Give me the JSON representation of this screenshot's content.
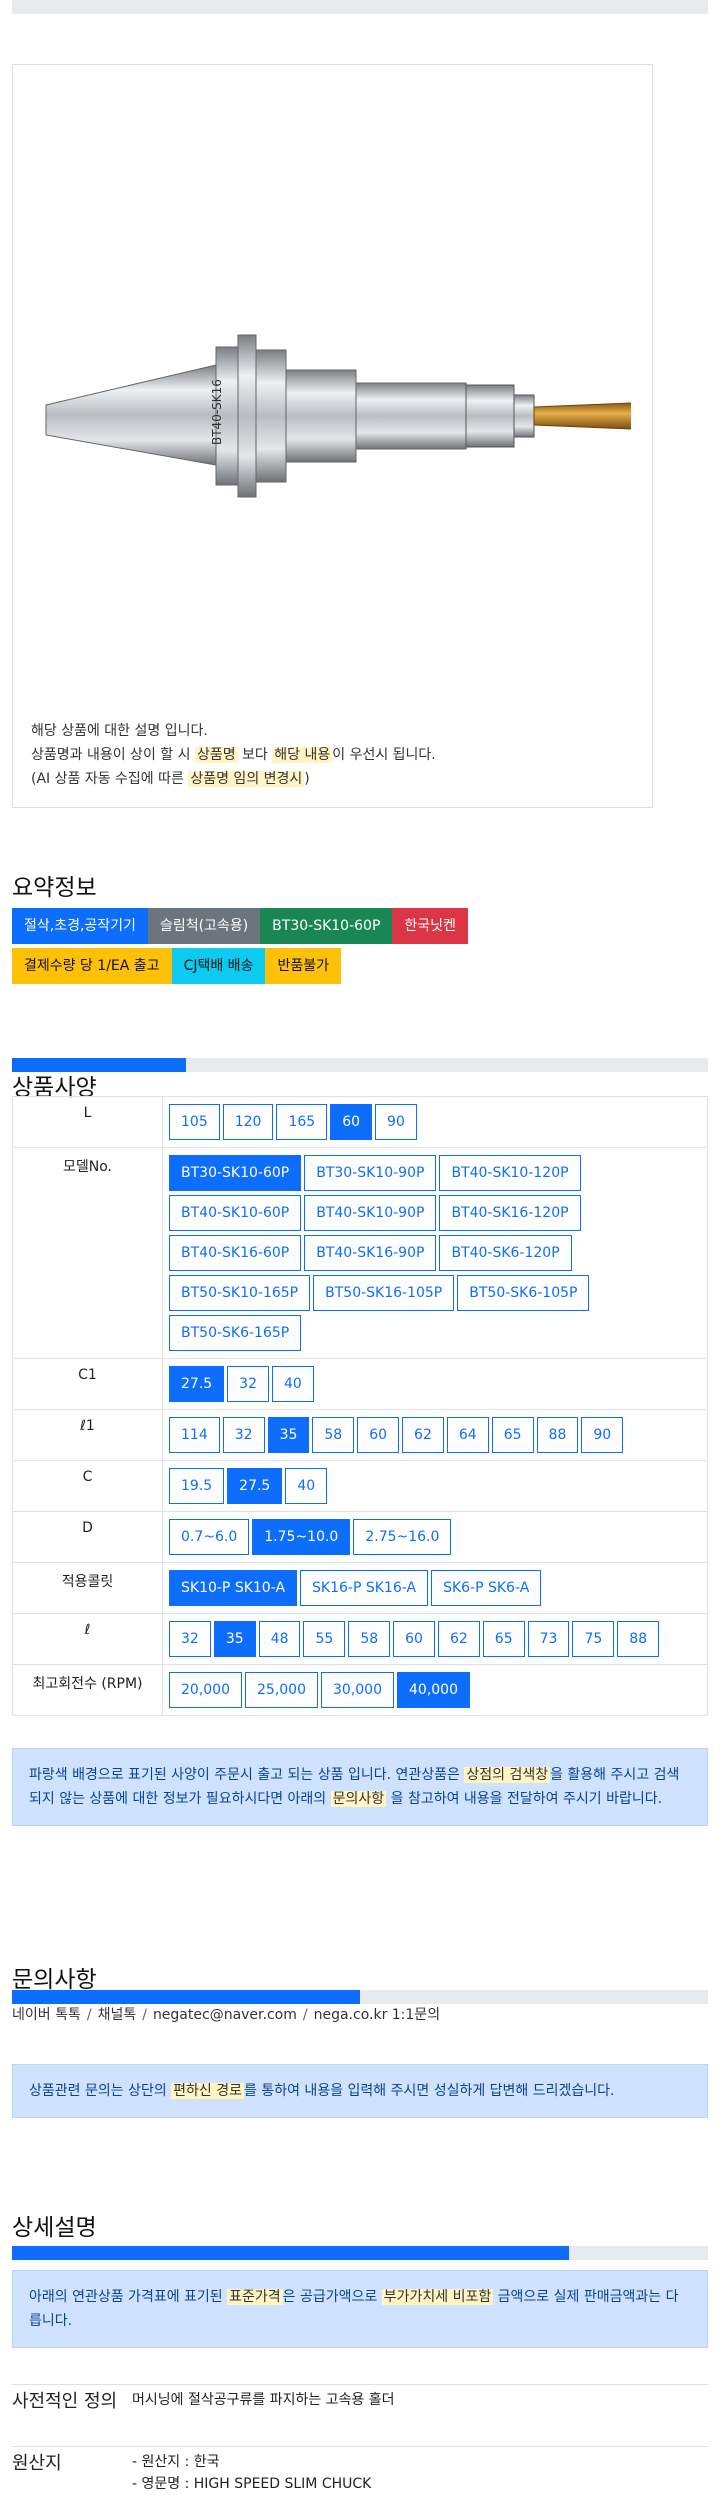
{
  "product_image_alt": "tool holder with drill",
  "product_image_label": "BT40-SK16",
  "description": {
    "line1": "해당 상품에 대한 설명 입니다.",
    "line2_a": "상품명과 내용이 상이 할 시 ",
    "line2_hl1": "상품명",
    "line2_b": " 보다 ",
    "line2_hl2": "해당 내용",
    "line2_c": "이 우선시 됩니다.",
    "line3_a": "(AI 상품 자동 수집에 따른 ",
    "line3_hl": "상품명 임의 변경시",
    "line3_b": ")"
  },
  "summary": {
    "title": "요약정보",
    "badges_row1": [
      {
        "label": "절삭,초경,공작기기",
        "color": "#0d6efd"
      },
      {
        "label": "슬림척(고속용)",
        "color": "#6c757d"
      },
      {
        "label": "BT30-SK10-60P",
        "color": "#198754"
      },
      {
        "label": "한국닛켄",
        "color": "#dc3545"
      }
    ],
    "badges_row2": [
      {
        "label": "결제수량 당 1/EA 출고",
        "color": "#ffc107"
      },
      {
        "label": "CJ택배 배송",
        "color": "#0dcaf0"
      },
      {
        "label": "반품불가",
        "color": "#ffc107"
      }
    ]
  },
  "spec": {
    "title": "상품사양",
    "progress": 0.25,
    "rows": [
      {
        "label": "L",
        "options": [
          "105",
          "120",
          "165",
          "60",
          "90"
        ],
        "selected": "60"
      },
      {
        "label": "모델No.",
        "options": [
          "BT30-SK10-60P",
          "BT30-SK10-90P",
          "BT40-SK10-120P",
          "BT40-SK10-60P",
          "BT40-SK10-90P",
          "BT40-SK16-120P",
          "BT40-SK16-60P",
          "BT40-SK16-90P",
          "BT40-SK6-120P",
          "BT50-SK10-165P",
          "BT50-SK16-105P",
          "BT50-SK6-105P",
          "BT50-SK6-165P"
        ],
        "selected": "BT30-SK10-60P"
      },
      {
        "label": "C1",
        "options": [
          "27.5",
          "32",
          "40"
        ],
        "selected": "27.5"
      },
      {
        "label": "ℓ1",
        "options": [
          "114",
          "32",
          "35",
          "58",
          "60",
          "62",
          "64",
          "65",
          "88",
          "90"
        ],
        "selected": "35"
      },
      {
        "label": "C",
        "options": [
          "19.5",
          "27.5",
          "40"
        ],
        "selected": "27.5"
      },
      {
        "label": "D",
        "options": [
          "0.7~6.0",
          "1.75~10.0",
          "2.75~16.0"
        ],
        "selected": "1.75~10.0"
      },
      {
        "label": "적용콜릿",
        "options": [
          "SK10-P SK10-A",
          "SK16-P SK16-A",
          "SK6-P SK6-A"
        ],
        "selected": "SK10-P SK10-A"
      },
      {
        "label": "ℓ",
        "options": [
          "32",
          "35",
          "48",
          "55",
          "58",
          "60",
          "62",
          "65",
          "73",
          "75",
          "88"
        ],
        "selected": "35"
      },
      {
        "label": "최고회전수 (RPM)",
        "options": [
          "20,000",
          "25,000",
          "30,000",
          "40,000"
        ],
        "selected": "40,000"
      }
    ],
    "notice": {
      "a": "파랑색 배경으로 표기된 사양이 주문시 출고 되는 상품 입니다. 연관상품은 ",
      "hl1": "상점의 검색창",
      "b": "을 활용해 주시고 검색되지 않는 상품에 대한 정보가 필요하시다면 아래의 ",
      "hl2": "문의사항",
      "c": " 을 참고하여 내용을 전달하여 주시기 바랍니다."
    }
  },
  "inquiry": {
    "title": "문의사항",
    "progress": 0.5,
    "links": [
      "네이버 톡톡",
      "채널톡",
      "negatec@naver.com",
      "nega.co.kr 1:1문의"
    ],
    "notice": {
      "a": "상품관련 문의는 상단의 ",
      "hl": "편하신 경로",
      "b": "를 통하여 내용을 입력해 주시면 성실하게 답변해 드리겠습니다."
    }
  },
  "detail": {
    "title": "상세설명",
    "progress": 0.8,
    "notice": {
      "a": "아래의 연관상품 가격표에 표기된 ",
      "hl1": "표준가격",
      "b": "은 공급가액으로 ",
      "hl2": "부가가치세 비포함",
      "c": " 금액으로 실제 판매금액과는 다릅니다."
    },
    "definition_label": "사전적인 정의",
    "definition_value": "머시닝에 절삭공구류를 파지하는 고속용 홀더",
    "origin_label": "원산지",
    "origin_value1": "- 원산지 : 한국",
    "origin_value2": "- 영문명 : HIGH SPEED SLIM CHUCK"
  }
}
